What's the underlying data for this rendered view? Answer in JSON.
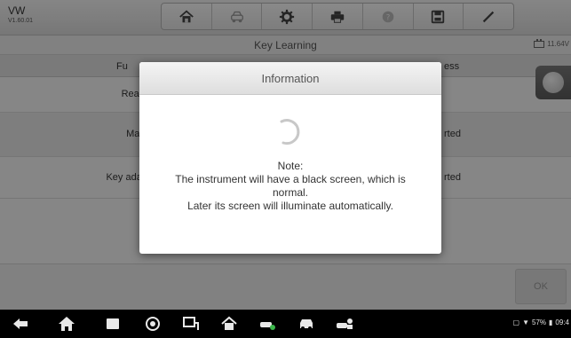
{
  "header": {
    "brand": "VW",
    "version": "V1.60.01"
  },
  "toolbar": {
    "items": [
      {
        "icon": "home-icon"
      },
      {
        "icon": "vehicle-swap-icon"
      },
      {
        "icon": "settings-gear-icon"
      },
      {
        "icon": "print-icon"
      },
      {
        "icon": "help-icon"
      },
      {
        "icon": "save-icon"
      },
      {
        "icon": "edit-pen-icon"
      }
    ]
  },
  "titlebar": {
    "title": "Key Learning",
    "voltage": "11.64V"
  },
  "table": {
    "col_function": "Fu",
    "col_status": "ess",
    "rows": [
      {
        "function": "Read I",
        "status": ""
      },
      {
        "function": "Make",
        "status": "rted"
      },
      {
        "function": "Key adapt",
        "status": "rted"
      },
      {
        "function": "",
        "status": ""
      }
    ]
  },
  "actionbar": {
    "ok_label": "OK"
  },
  "dialog": {
    "title": "Information",
    "note_title": "Note:",
    "note_line1": "The instrument will have a black screen, which is",
    "note_line2": "normal.",
    "note_line3": "Later its screen will illuminate automatically."
  },
  "navbar": {
    "items": [
      {
        "icon": "back-icon"
      },
      {
        "icon": "home-icon"
      },
      {
        "icon": "recent-apps-icon"
      },
      {
        "icon": "browser-icon"
      },
      {
        "icon": "vci-connect-icon"
      },
      {
        "icon": "diagnostics-home-icon"
      },
      {
        "icon": "car-service-icon"
      },
      {
        "icon": "car-icon"
      },
      {
        "icon": "car-user-icon"
      }
    ],
    "battery": "57%",
    "time": "09:4"
  },
  "colors": {
    "overlay": "#000000",
    "dialog_bg": "#ffffff",
    "nav_bg": "#000000"
  }
}
